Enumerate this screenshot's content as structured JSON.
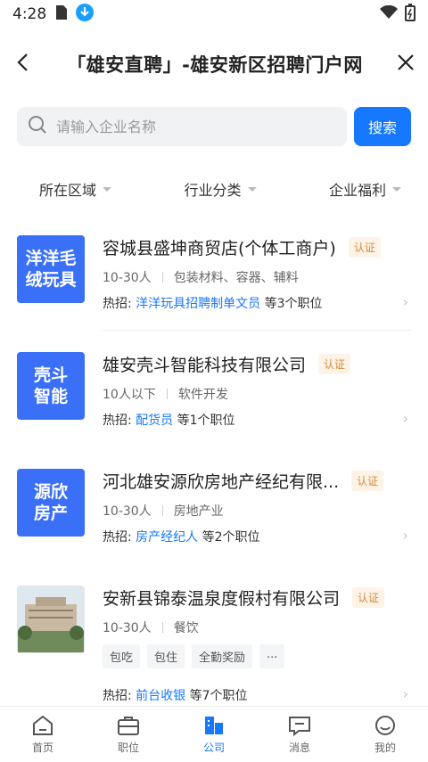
{
  "status": {
    "time": "4:28"
  },
  "header": {
    "title": "「雄安直聘」-雄安新区招聘门户网"
  },
  "search": {
    "placeholder": "请输入企业名称",
    "button_label": "搜索"
  },
  "filters": [
    "所在区域",
    "行业分类",
    "企业福利"
  ],
  "companies": [
    {
      "logo_text_1": "洋洋毛",
      "logo_text_2": "绒玩具",
      "name": "容城县盛坤商贸店(个体工商户)",
      "badge": "认证",
      "size": "10-30人",
      "industry": "包装材料、容器、辅料",
      "hot_label": "热招:",
      "hot_job": "洋洋玩具招聘制单文员",
      "hot_count": "等3个职位"
    },
    {
      "logo_text_1": "壳斗",
      "logo_text_2": "智能",
      "name": "雄安壳斗智能科技有限公司",
      "badge": "认证",
      "size": "10人以下",
      "industry": "软件开发",
      "hot_label": "热招:",
      "hot_job": "配货员",
      "hot_count": "等1个职位"
    },
    {
      "logo_text_1": "源欣",
      "logo_text_2": "房产",
      "name": "河北雄安源欣房地产经纪有限...",
      "badge": "认证",
      "size": "10-30人",
      "industry": "房地产业",
      "hot_label": "热招:",
      "hot_job": "房产经纪人",
      "hot_count": "等2个职位"
    },
    {
      "name": "安新县锦泰温泉度假村有限公司",
      "badge": "认证",
      "size": "10-30人",
      "industry": "餐饮",
      "tags": [
        "包吃",
        "包住",
        "全勤奖励",
        "..."
      ],
      "hot_label": "热招:",
      "hot_job": "前台收银",
      "hot_count": "等7个职位"
    }
  ],
  "tabbar": [
    {
      "label": "首页"
    },
    {
      "label": "职位"
    },
    {
      "label": "公司",
      "active": true
    },
    {
      "label": "消息"
    },
    {
      "label": "我的"
    }
  ],
  "colors": {
    "accent": "#1677ff",
    "logo_blue": "#3a6ff7",
    "badge_bg": "#fdf3e6",
    "badge_text": "#d58a3c"
  }
}
